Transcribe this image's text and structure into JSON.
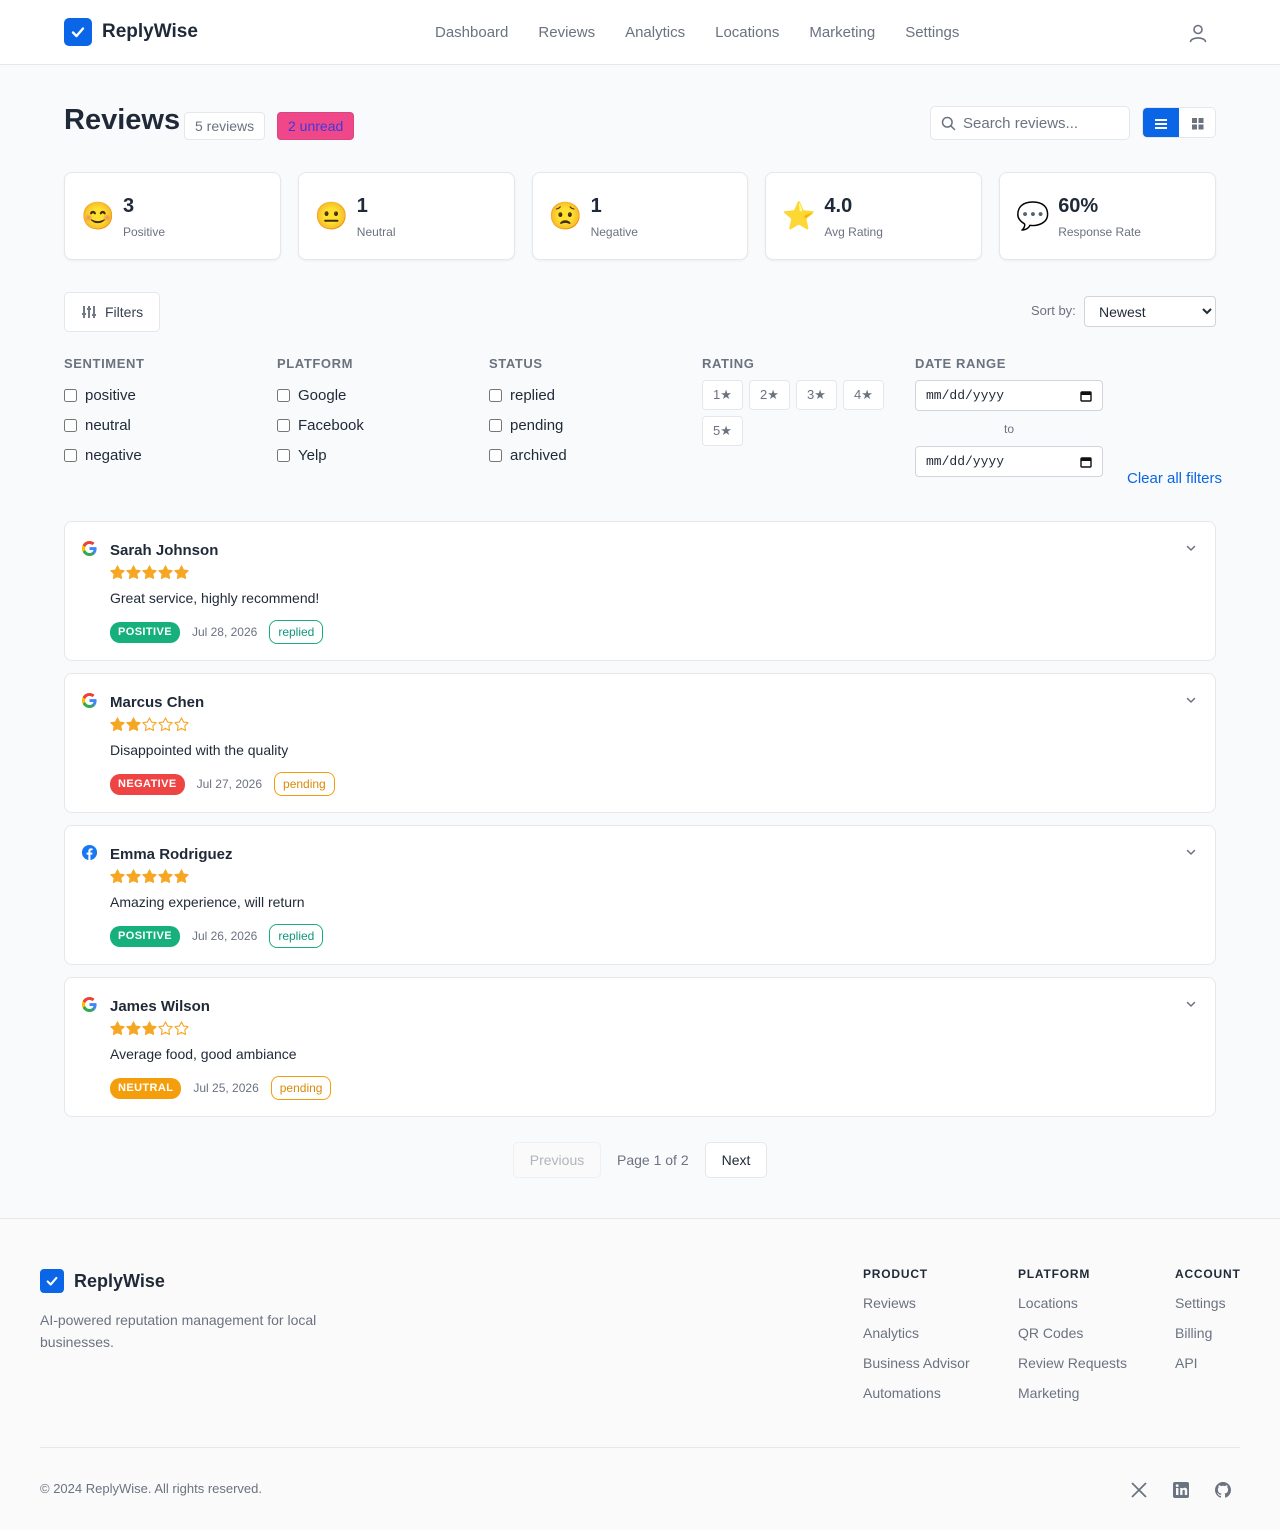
{
  "brand": {
    "name": "ReplyWise"
  },
  "nav": {
    "items": [
      "Dashboard",
      "Reviews",
      "Analytics",
      "Locations",
      "Marketing",
      "Settings"
    ]
  },
  "header": {
    "title": "Reviews",
    "count_badge": "5 reviews",
    "unread_badge": "2 unread",
    "search_placeholder": "Search reviews...",
    "view_mode": "list"
  },
  "stats": [
    {
      "icon": "smile-emoji",
      "emoji": "😊",
      "value": "3",
      "label": "Positive"
    },
    {
      "icon": "neutral-face-emoji",
      "emoji": "😐",
      "value": "1",
      "label": "Neutral"
    },
    {
      "icon": "worried-face-emoji",
      "emoji": "😟",
      "value": "1",
      "label": "Negative"
    },
    {
      "icon": "star-emoji",
      "emoji": "⭐",
      "value": "4.0",
      "label": "Avg Rating"
    },
    {
      "icon": "speech-bubble-emoji",
      "emoji": "💬",
      "value": "60%",
      "label": "Response Rate"
    }
  ],
  "filters": {
    "button_label": "Filters",
    "sort_label": "Sort by:",
    "sort_value": "Newest",
    "sentiment": {
      "title": "SENTIMENT",
      "options": [
        "positive",
        "neutral",
        "negative"
      ]
    },
    "platform": {
      "title": "PLATFORM",
      "options": [
        "Google",
        "Facebook",
        "Yelp"
      ]
    },
    "status": {
      "title": "STATUS",
      "options": [
        "replied",
        "pending",
        "archived"
      ]
    },
    "rating": {
      "title": "RATING",
      "options": [
        "1★",
        "2★",
        "3★",
        "4★",
        "5★"
      ]
    },
    "date_range": {
      "title": "DATE RANGE",
      "from_placeholder": "mm/dd/yyyy",
      "to_label": "to",
      "to_placeholder": "mm/dd/yyyy"
    },
    "clear_label": "Clear all filters"
  },
  "reviews": [
    {
      "name": "Sarah Johnson",
      "platform": "google",
      "rating": 5,
      "text": "Great service, highly recommend!",
      "sentiment": "POSITIVE",
      "date": "Jul 28, 2026",
      "status": "replied"
    },
    {
      "name": "Marcus Chen",
      "platform": "google",
      "rating": 2,
      "text": "Disappointed with the quality",
      "sentiment": "NEGATIVE",
      "date": "Jul 27, 2026",
      "status": "pending"
    },
    {
      "name": "Emma Rodriguez",
      "platform": "facebook",
      "rating": 5,
      "text": "Amazing experience, will return",
      "sentiment": "POSITIVE",
      "date": "Jul 26, 2026",
      "status": "replied"
    },
    {
      "name": "James Wilson",
      "platform": "google",
      "rating": 3,
      "text": "Average food, good ambiance",
      "sentiment": "NEUTRAL",
      "date": "Jul 25, 2026",
      "status": "pending"
    }
  ],
  "pagination": {
    "prev": "Previous",
    "info": "Page 1 of 2",
    "next": "Next"
  },
  "footer": {
    "brand": "ReplyWise",
    "tagline": "AI-powered reputation management for local businesses.",
    "columns": [
      {
        "title": "PRODUCT",
        "links": [
          "Reviews",
          "Analytics",
          "Business Advisor",
          "Automations"
        ]
      },
      {
        "title": "PLATFORM",
        "links": [
          "Locations",
          "QR Codes",
          "Review Requests",
          "Marketing"
        ]
      },
      {
        "title": "ACCOUNT",
        "links": [
          "Settings",
          "Billing",
          "API"
        ]
      }
    ],
    "copyright": "© 2024 ReplyWise. All rights reserved.",
    "social": [
      "x-icon",
      "linkedin-icon",
      "github-icon"
    ]
  },
  "colors": {
    "accent": "#0a66e6",
    "positive": "#16b07c",
    "negative": "#ef4444",
    "neutral": "#f59e0b",
    "unread": "#f0478a",
    "star": "#f5a623"
  }
}
